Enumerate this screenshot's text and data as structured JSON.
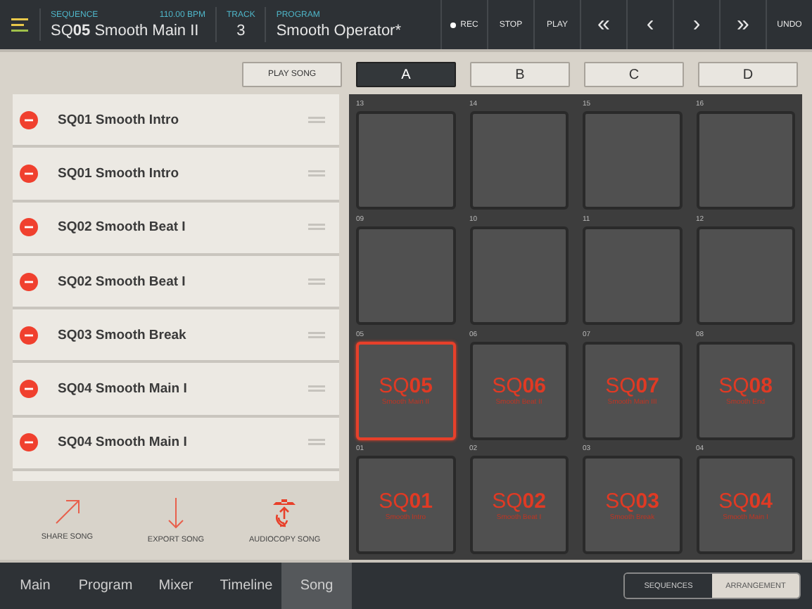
{
  "header": {
    "sequence_label": "SEQUENCE",
    "bpm": "110.00 BPM",
    "sequence": "SQ**05** Smooth Main II",
    "track_label": "TRACK",
    "track": "3",
    "program_label": "PROGRAM",
    "program": "Smooth Operator*",
    "transport": [
      {
        "kind": "rec",
        "label": "REC"
      },
      {
        "kind": "text",
        "label": "STOP"
      },
      {
        "kind": "text",
        "label": "PLAY"
      },
      {
        "kind": "text",
        "label": "«"
      },
      {
        "kind": "text",
        "label": "‹"
      },
      {
        "kind": "text",
        "label": "›"
      },
      {
        "kind": "text",
        "label": "»"
      },
      {
        "kind": "text",
        "label": "UNDO"
      }
    ]
  },
  "play_song": "PLAY SONG",
  "banks": [
    {
      "label": "A",
      "selected": true
    },
    {
      "label": "B",
      "selected": false
    },
    {
      "label": "C",
      "selected": false
    },
    {
      "label": "D",
      "selected": false
    }
  ],
  "song_list": [
    {
      "name": "SQ01 Smooth Intro"
    },
    {
      "name": "SQ01 Smooth Intro"
    },
    {
      "name": "SQ02 Smooth Beat I"
    },
    {
      "name": "SQ02 Smooth Beat I"
    },
    {
      "name": "SQ03 Smooth Break"
    },
    {
      "name": "SQ04 Smooth Main I"
    },
    {
      "name": "SQ04 Smooth Main I"
    }
  ],
  "actions": [
    {
      "kind": "share",
      "label": "SHARE SONG"
    },
    {
      "kind": "export",
      "label": "EXPORT SONG"
    },
    {
      "kind": "audiocopy",
      "label": "AUDIOCOPY SONG"
    }
  ],
  "pads": [
    {
      "number": "13",
      "selected": false
    },
    {
      "number": "14",
      "selected": false
    },
    {
      "number": "15",
      "selected": false
    },
    {
      "number": "16",
      "selected": false
    },
    {
      "number": "09",
      "selected": false
    },
    {
      "number": "10",
      "selected": false
    },
    {
      "number": "11",
      "selected": false
    },
    {
      "number": "12",
      "selected": false
    },
    {
      "number": "05",
      "name": "SQ**05**",
      "sub": "Smooth Main II",
      "selected": true
    },
    {
      "number": "06",
      "name": "SQ**06**",
      "sub": "Smooth Beat II",
      "selected": false
    },
    {
      "number": "07",
      "name": "SQ**07**",
      "sub": "Smooth Main III",
      "selected": false
    },
    {
      "number": "08",
      "name": "SQ**08**",
      "sub": "Smooth End",
      "selected": false
    },
    {
      "number": "01",
      "name": "SQ**01**",
      "sub": "Smooth Intro",
      "selected": false
    },
    {
      "number": "02",
      "name": "SQ**02**",
      "sub": "Smooth Beat I",
      "selected": false
    },
    {
      "number": "03",
      "name": "SQ**03**",
      "sub": "Smooth Break",
      "selected": false
    },
    {
      "number": "04",
      "name": "SQ**04**",
      "sub": "Smooth Main I",
      "selected": false
    }
  ],
  "tabs": [
    {
      "label": "Main",
      "selected": false
    },
    {
      "label": "Program",
      "selected": false
    },
    {
      "label": "Mixer",
      "selected": false
    },
    {
      "label": "Timeline",
      "selected": false
    },
    {
      "label": "Song",
      "selected": true
    }
  ],
  "view_toggle": [
    {
      "label": "SEQUENCES",
      "selected": false
    },
    {
      "label": "ARRANGEMENT",
      "selected": true
    }
  ]
}
